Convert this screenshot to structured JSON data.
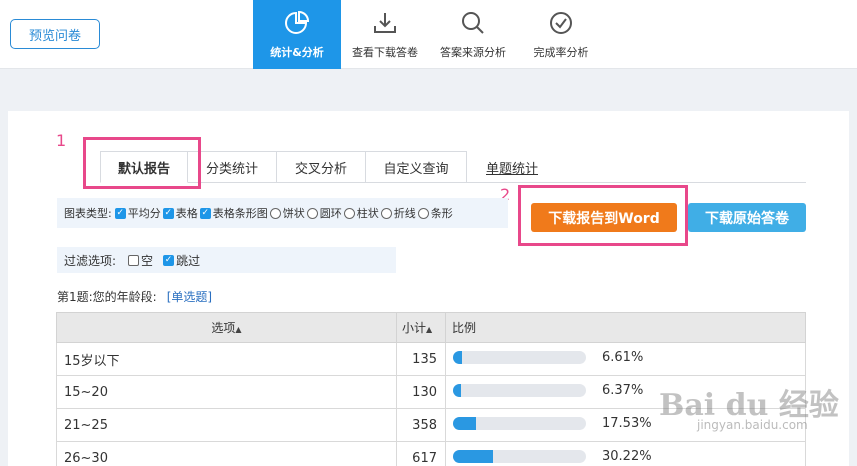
{
  "topbar": {
    "preview_label": "预览问卷",
    "tabs": [
      {
        "label": "统计&分析",
        "icon": "pie-chart-icon"
      },
      {
        "label": "查看下载答卷",
        "icon": "download-icon"
      },
      {
        "label": "答案来源分析",
        "icon": "search-icon"
      },
      {
        "label": "完成率分析",
        "icon": "check-circle-icon"
      }
    ]
  },
  "annotations": {
    "step1": "1",
    "step2": "2"
  },
  "subtabs": [
    "默认报告",
    "分类统计",
    "交叉分析",
    "自定义查询"
  ],
  "single_stat_label": "单题统计",
  "chart_types": {
    "label": "图表类型:",
    "options": [
      {
        "label": "平均分",
        "checked": true
      },
      {
        "label": "表格",
        "checked": true
      },
      {
        "label": "表格条形图",
        "checked": true
      },
      {
        "label": "饼状",
        "checked": false
      },
      {
        "label": "圆环",
        "checked": false
      },
      {
        "label": "柱状",
        "checked": false
      },
      {
        "label": "折线",
        "checked": false
      },
      {
        "label": "条形",
        "checked": false
      }
    ]
  },
  "buttons": {
    "download_word": "下载报告到Word",
    "download_raw": "下载原始答卷"
  },
  "filter": {
    "label": "过滤选项:",
    "options": [
      {
        "label": "空",
        "checked": false
      },
      {
        "label": "跳过",
        "checked": true
      }
    ]
  },
  "question": {
    "title": "第1题:您的年龄段:",
    "type": "[单选题]"
  },
  "table": {
    "headers": {
      "option": "选项",
      "count": "小计",
      "ratio": "比例",
      "sort_icon": "sort-icon"
    },
    "rows": [
      {
        "option": "15岁以下",
        "count": "135",
        "percent": "6.61%",
        "fraction": 0.0661
      },
      {
        "option": "15~20",
        "count": "130",
        "percent": "6.37%",
        "fraction": 0.0637
      },
      {
        "option": "21~25",
        "count": "358",
        "percent": "17.53%",
        "fraction": 0.1753
      },
      {
        "option": "26~30",
        "count": "617",
        "percent": "30.22%",
        "fraction": 0.3022
      }
    ]
  },
  "watermark": {
    "text": "Bai du 经验",
    "sub": "jingyan.baidu.com"
  },
  "colors": {
    "primary": "#1e96e8",
    "orange": "#f07a1b",
    "light_blue": "#40aee6",
    "highlight": "#e8488a"
  }
}
